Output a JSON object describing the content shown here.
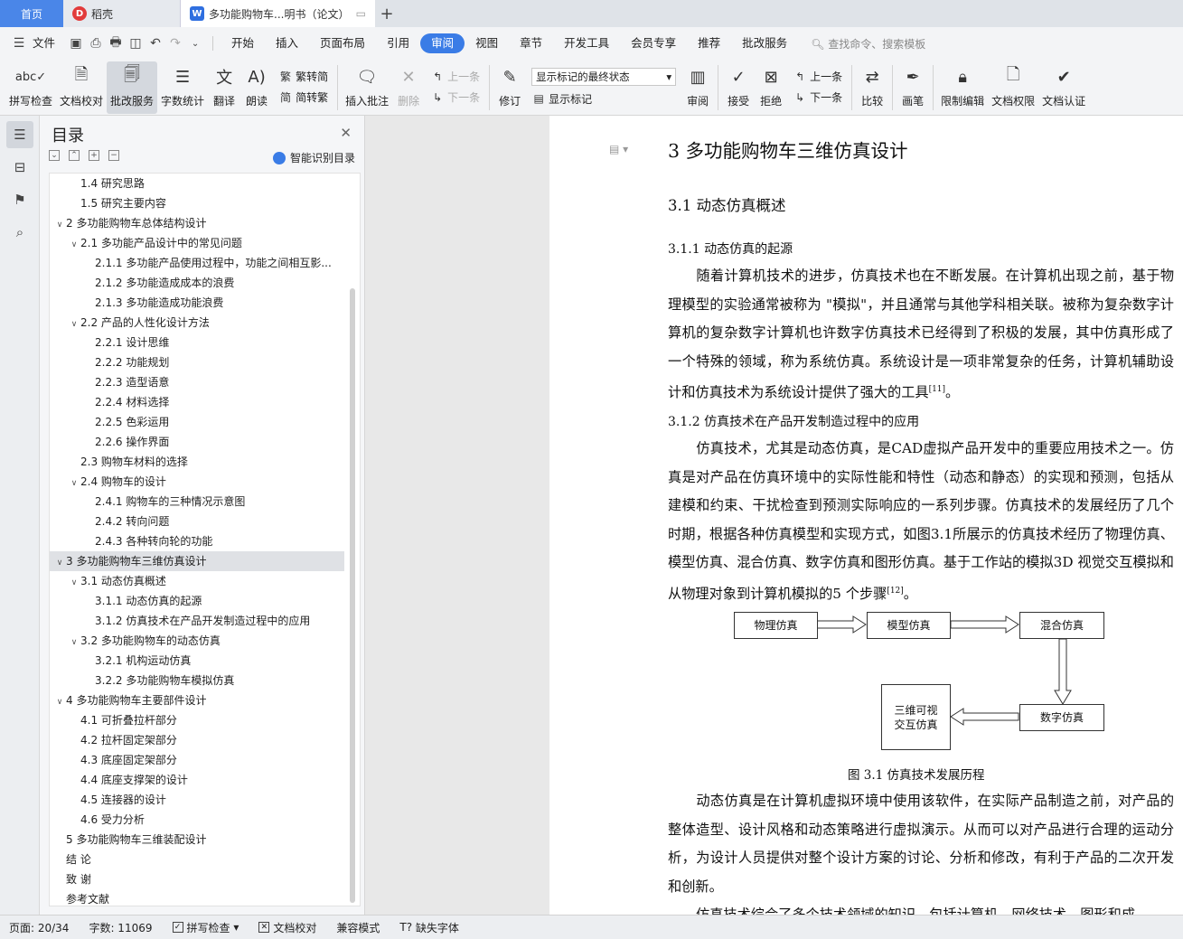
{
  "tabs": {
    "home": "首页",
    "daoke": "稻壳",
    "doc": "多功能购物车...明书（论文）"
  },
  "menubar": {
    "file": "文件",
    "items": [
      "开始",
      "插入",
      "页面布局",
      "引用",
      "审阅",
      "视图",
      "章节",
      "开发工具",
      "会员专享",
      "推荐",
      "批改服务"
    ],
    "active": "审阅",
    "search": "查找命令、搜索模板"
  },
  "ribbon": {
    "spellcheck": "拼写检查",
    "proofread": "文档校对",
    "correction": "批改服务",
    "wordcount": "字数统计",
    "translate": "翻译",
    "read": "朗读",
    "to_traditional": "繁转简",
    "to_simplified": "简转繁",
    "insert_comment": "插入批注",
    "delete": "删除",
    "prev1": "上一条",
    "next1": "下一条",
    "revise": "修订",
    "display_state": "显示标记的最终状态",
    "show_marks": "显示标记",
    "review": "审阅",
    "accept": "接受",
    "reject": "拒绝",
    "prev2": "上一条",
    "next2": "下一条",
    "compare": "比较",
    "pen": "画笔",
    "restrict": "限制编辑",
    "permission": "文档权限",
    "certify": "文档认证"
  },
  "toc": {
    "title": "目录",
    "smart": "智能识别目录",
    "entries": [
      {
        "text": "1.4 研究思路",
        "level": 2,
        "arrow": ""
      },
      {
        "text": "1.5 研究主要内容",
        "level": 2,
        "arrow": ""
      },
      {
        "text": "2  多功能购物车总体结构设计",
        "level": 1,
        "arrow": "v"
      },
      {
        "text": "2.1  多功能产品设计中的常见问题",
        "level": 2,
        "arrow": "v"
      },
      {
        "text": "2.1.1  多功能产品使用过程中，功能之间相互影...",
        "level": 3,
        "arrow": ""
      },
      {
        "text": "2.1.2  多功能造成成本的浪费",
        "level": 3,
        "arrow": ""
      },
      {
        "text": "2.1.3  多功能造成功能浪费",
        "level": 3,
        "arrow": ""
      },
      {
        "text": "2.2  产品的人性化设计方法",
        "level": 2,
        "arrow": "v"
      },
      {
        "text": "2.2.1  设计思维",
        "level": 3,
        "arrow": ""
      },
      {
        "text": "2.2.2  功能规划",
        "level": 3,
        "arrow": ""
      },
      {
        "text": "2.2.3  造型语意",
        "level": 3,
        "arrow": ""
      },
      {
        "text": "2.2.4  材料选择",
        "level": 3,
        "arrow": ""
      },
      {
        "text": "2.2.5  色彩运用",
        "level": 3,
        "arrow": ""
      },
      {
        "text": "2.2.6  操作界面",
        "level": 3,
        "arrow": ""
      },
      {
        "text": "2.3  购物车材料的选择",
        "level": 2,
        "arrow": ""
      },
      {
        "text": "2.4  购物车的设计",
        "level": 2,
        "arrow": "v"
      },
      {
        "text": "2.4.1  购物车的三种情况示意图",
        "level": 3,
        "arrow": ""
      },
      {
        "text": "2.4.2  转向问题",
        "level": 3,
        "arrow": ""
      },
      {
        "text": "2.4.3 各种转向轮的功能",
        "level": 3,
        "arrow": ""
      },
      {
        "text": "3  多功能购物车三维仿真设计",
        "level": 1,
        "arrow": "v",
        "selected": true
      },
      {
        "text": "3.1  动态仿真概述",
        "level": 2,
        "arrow": "v"
      },
      {
        "text": "3.1.1  动态仿真的起源",
        "level": 3,
        "arrow": ""
      },
      {
        "text": "3.1.2  仿真技术在产品开发制造过程中的应用",
        "level": 3,
        "arrow": ""
      },
      {
        "text": "3.2  多功能购物车的动态仿真",
        "level": 2,
        "arrow": "v"
      },
      {
        "text": "3.2.1  机构运动仿真",
        "level": 3,
        "arrow": ""
      },
      {
        "text": "3.2.2  多功能购物车模拟仿真",
        "level": 3,
        "arrow": ""
      },
      {
        "text": "4  多功能购物车主要部件设计",
        "level": 1,
        "arrow": "v"
      },
      {
        "text": "4.1  可折叠拉杆部分",
        "level": 2,
        "arrow": ""
      },
      {
        "text": "4.2  拉杆固定架部分",
        "level": 2,
        "arrow": ""
      },
      {
        "text": "4.3  底座固定架部分",
        "level": 2,
        "arrow": ""
      },
      {
        "text": "4.4 底座支撑架的设计",
        "level": 2,
        "arrow": ""
      },
      {
        "text": "4.5 连接器的设计",
        "level": 2,
        "arrow": ""
      },
      {
        "text": "4.6  受力分析",
        "level": 2,
        "arrow": ""
      },
      {
        "text": "5  多功能购物车三维装配设计",
        "level": 1,
        "arrow": ""
      },
      {
        "text": "结   论",
        "level": 1,
        "arrow": ""
      },
      {
        "text": "致   谢",
        "level": 1,
        "arrow": ""
      },
      {
        "text": "参考文献",
        "level": 1,
        "arrow": ""
      }
    ]
  },
  "document": {
    "h1": "3  多功能购物车三维仿真设计",
    "h2": "3.1  动态仿真概述",
    "h3a": "3.1.1  动态仿真的起源",
    "para1": "随着计算机技术的进步，仿真技术也在不断发展。在计算机出现之前，基于物理模型的实验通常被称为 \"模拟\"，并且通常与其他学科相关联。被称为复杂数字计算机的复杂数字计算机也许数字仿真技术已经得到了积极的发展，其中仿真形成了一个特殊的领域，称为系统仿真。系统设计是一项非常复杂的任务，计算机辅助设计和仿真技术为系统设计提供了强大的工具",
    "para1_ref": "[11]",
    "para1_end": "。",
    "h3b": "3.1.2  仿真技术在产品开发制造过程中的应用",
    "para2": "仿真技术，尤其是动态仿真，是CAD虚拟产品开发中的重要应用技术之一。仿真是对产品在仿真环境中的实际性能和特性（动态和静态）的实现和预测，包括从建模和约束、干扰检查到预测实际响应的一系列步骤。仿真技术的发展经历了几个时期，根据各种仿真模型和实现方式，如图3.1所展示的仿真技术经历了物理仿真、模型仿真、混合仿真、数字仿真和图形仿真。基于工作站的模拟3D  视觉交互模拟和从物理对象到计算机模拟的5  个步骤",
    "para2_ref": "[12]",
    "para2_end": "。",
    "diagram": {
      "physical": "物理仿真",
      "model": "模型仿真",
      "hybrid": "混合仿真",
      "digital": "数字仿真",
      "visual_line1": "三维可视",
      "visual_line2": "交互仿真"
    },
    "caption": "图 3.1  仿真技术发展历程",
    "para3": "动态仿真是在计算机虚拟环境中使用该软件，在实际产品制造之前，对产品的整体造型、设计风格和动态策略进行虚拟演示。从而可以对产品进行合理的运动分析，为设计人员提供对整个设计方案的讨论、分析和修改，有利于产品的二次开发和创新。",
    "para4": "仿真技术综合了多个技术领域的知识，包括计算机、网络技术、图形和成"
  },
  "status": {
    "page": "页面: 20/34",
    "words": "字数: 11069",
    "spell": "拼写检查",
    "proof": "文档校对",
    "compat": "兼容模式",
    "missing_font": "缺失字体"
  }
}
